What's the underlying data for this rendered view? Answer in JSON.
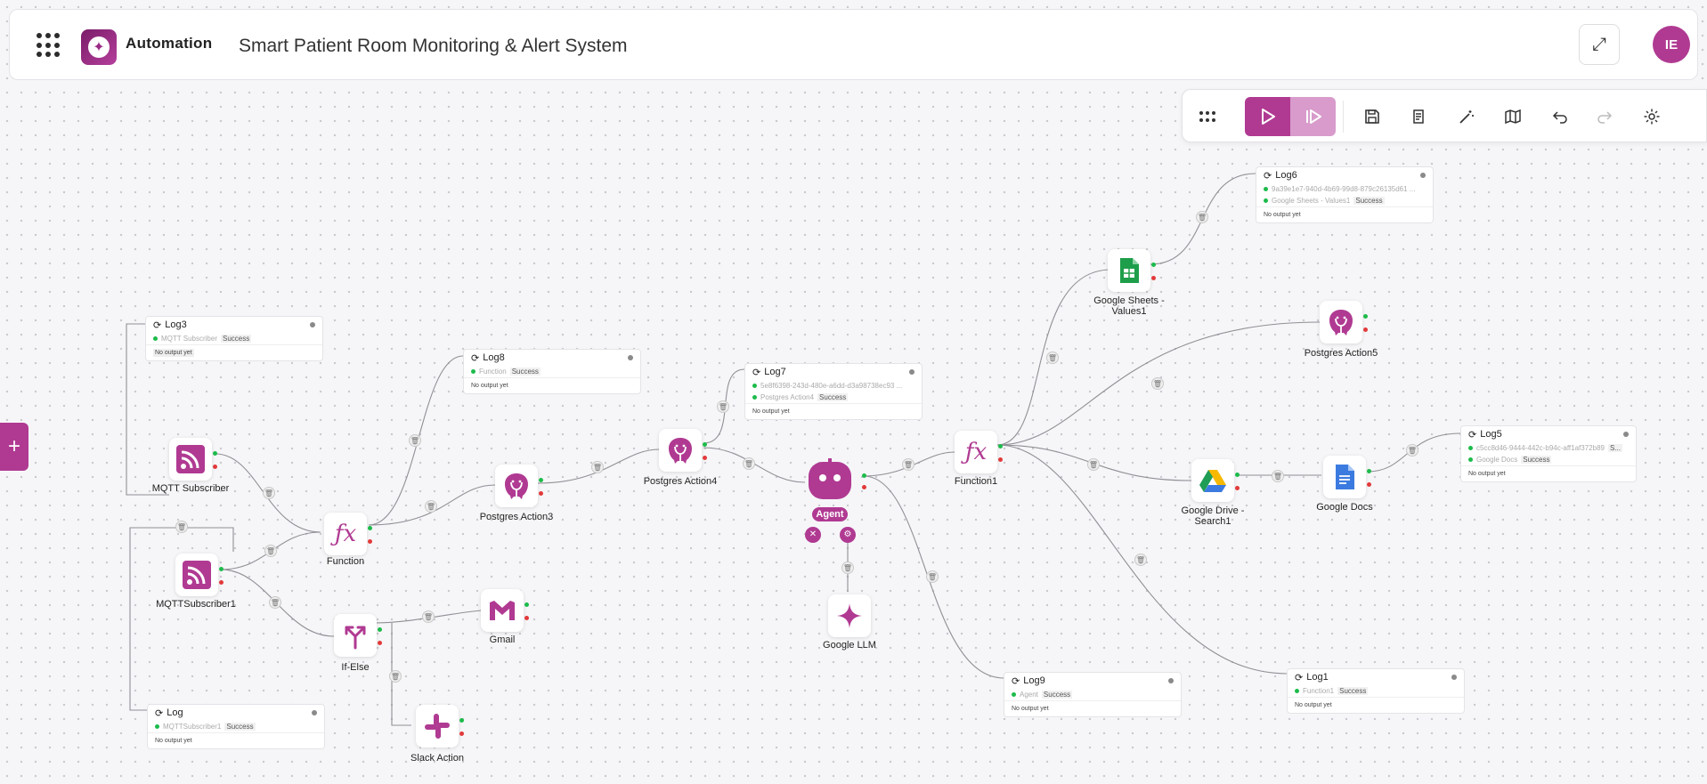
{
  "header": {
    "brand": "Automation",
    "title": "Smart Patient Room Monitoring & Alert System",
    "avatar": "IE"
  },
  "colors": {
    "accent": "#b03a92",
    "accent_light": "#d89bcb",
    "success": "#1dbb4a",
    "error": "#e23a3a"
  },
  "nodes": {
    "mqtt": "MQTT Subscriber",
    "mqtt1": "MQTTSubscriber1",
    "function": "Function",
    "ifelse": "If-Else",
    "pg3": "Postgres Action3",
    "pg4": "Postgres Action4",
    "gmail": "Gmail",
    "slack": "Slack Action",
    "agent": "Agent",
    "llm": "Google LLM",
    "function1": "Function1",
    "sheets": "Google Sheets - Values1",
    "pg5": "Postgres Action5",
    "drive": "Google Drive - Search1",
    "docs": "Google Docs"
  },
  "logs": {
    "log3": {
      "title": "Log3",
      "source": "MQTT Subscriber",
      "status": "Success",
      "output": "No output yet"
    },
    "log8": {
      "title": "Log8",
      "source": "Function",
      "status": "Success",
      "output": "No output yet"
    },
    "log7": {
      "title": "Log7",
      "id": "5e8f6398-243d-480e-a6dd-d3a98738ec93 ...",
      "source": "Postgres Action4",
      "status": "Success",
      "output": "No output yet"
    },
    "log6": {
      "title": "Log6",
      "id": "9a39e1e7-940d-4b69-99d8-879c26135d61 ...",
      "source": "Google Sheets - Values1",
      "status": "Success",
      "output": "No output yet"
    },
    "log5": {
      "title": "Log5",
      "id": "c5cc8d46-9444-442c-b94c-aff1af372b89",
      "id_suffix": "S...",
      "source": "Google Docs",
      "status": "Success",
      "output": "No output yet"
    },
    "log9": {
      "title": "Log9",
      "source": "Agent",
      "status": "Success",
      "output": "No output yet"
    },
    "log1": {
      "title": "Log1",
      "source": "Function1",
      "status": "Success",
      "output": "No output yet"
    },
    "log": {
      "title": "Log",
      "source": "MQTTSubscriber1",
      "status": "Success",
      "output": "No output yet"
    }
  }
}
